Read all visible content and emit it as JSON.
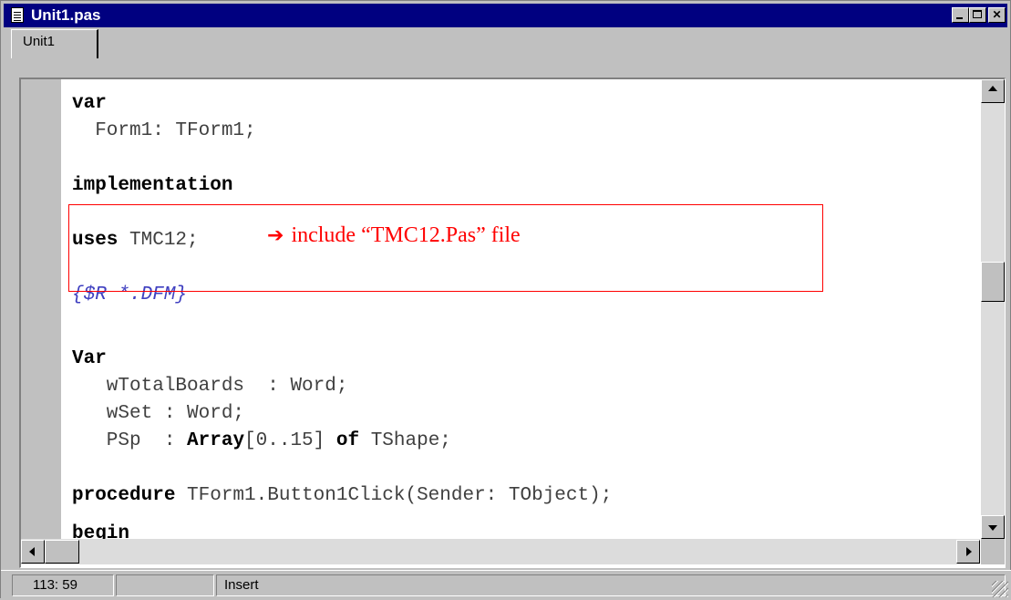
{
  "window": {
    "title": "Unit1.pas",
    "icon": "document-icon",
    "controls": [
      "minimize-icon",
      "maximize-icon",
      "close-icon"
    ]
  },
  "tabs": [
    {
      "label": "Unit1",
      "active": true
    }
  ],
  "code": {
    "line1_kw": "var",
    "line2": "  Form1: TForm1;",
    "line3_kw": "implementation",
    "line4_kw": "uses",
    "line4_rest": " TMC12;",
    "line5_comment": "{$R *.DFM}",
    "line6_kw": "Var",
    "line7": "   wTotalBoards  : Word;",
    "line8": "   wSet : Word;",
    "line9_a": "   PSp  : ",
    "line9_kw1": "Array",
    "line9_b": "[0..15] ",
    "line9_kw2": "of",
    "line9_c": " TShape;",
    "line10_kw": "procedure",
    "line10_rest": " TForm1.Button1Click(Sender: TObject);",
    "line11_kw": "begin"
  },
  "annotation": {
    "arrow": "➔",
    "text": "include “TMC12.Pas” file",
    "color": "#ff0000"
  },
  "statusbar": {
    "position": "113: 59",
    "modified": "",
    "mode": "Insert"
  },
  "colors": {
    "titlebar": "#000080",
    "keyword": "#000000",
    "comment": "#4040c0",
    "chrome": "#c0c0c0"
  }
}
